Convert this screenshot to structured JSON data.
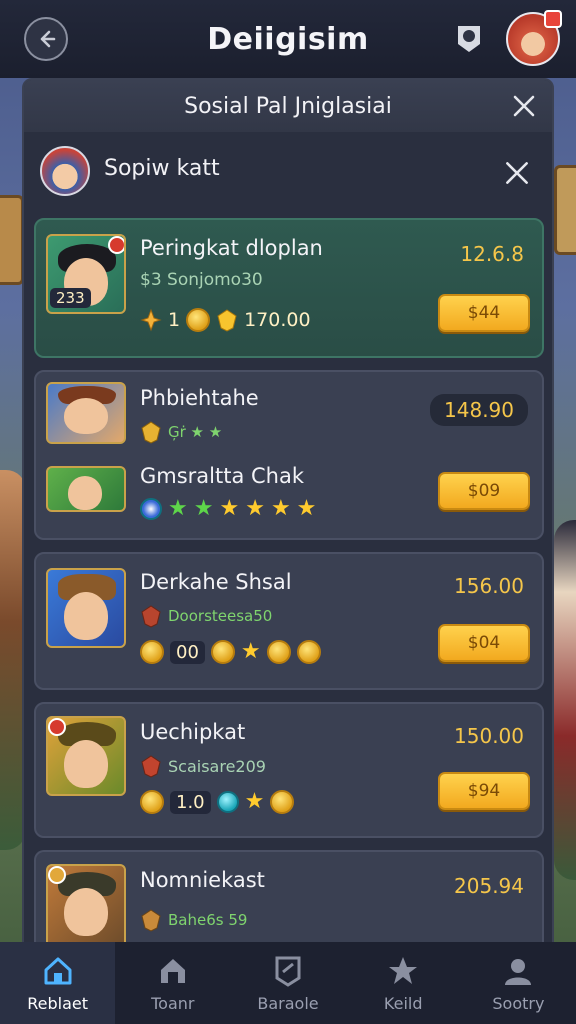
{
  "app_title": "Deiigisim",
  "panel_title": "Sosial Pal Jniglasiai",
  "sub_title": "Sopiw katt",
  "colors": {
    "accent_gold": "#f5c64a",
    "highlight_card": "#2f5a50",
    "panel": "#2a2f3f"
  },
  "cards": [
    {
      "title": "Peringkat dloplan",
      "subtitle": "$3 Sonjomo30",
      "price": "12.6.8",
      "button": "$44",
      "thumb_badge": "233",
      "stat_a": "1",
      "stat_b": "170.00"
    },
    {
      "title": "Phbiehtahe",
      "subtitle": "Ģṙ ★ ★",
      "price": "148.90",
      "title2": "Gmsraltta Chak",
      "button": "$09"
    },
    {
      "title": "Derkahe Shsal",
      "subtitle": "Doorsteesa50",
      "price": "156.00",
      "button": "$04",
      "stat": "00"
    },
    {
      "title": "Uechipkat",
      "subtitle": "Scaisare209",
      "price": "150.00",
      "button": "$94",
      "stat": "1.0"
    },
    {
      "title": "Nomniekast",
      "subtitle": "Bahe6s 59",
      "price": "205.94"
    }
  ],
  "nav": [
    {
      "label": "Reblaet",
      "icon": "home-icon"
    },
    {
      "label": "Toanr",
      "icon": "shop-icon"
    },
    {
      "label": "Baraole",
      "icon": "badge-icon"
    },
    {
      "label": "Keild",
      "icon": "star-icon"
    },
    {
      "label": "Sootry",
      "icon": "profile-icon"
    }
  ]
}
